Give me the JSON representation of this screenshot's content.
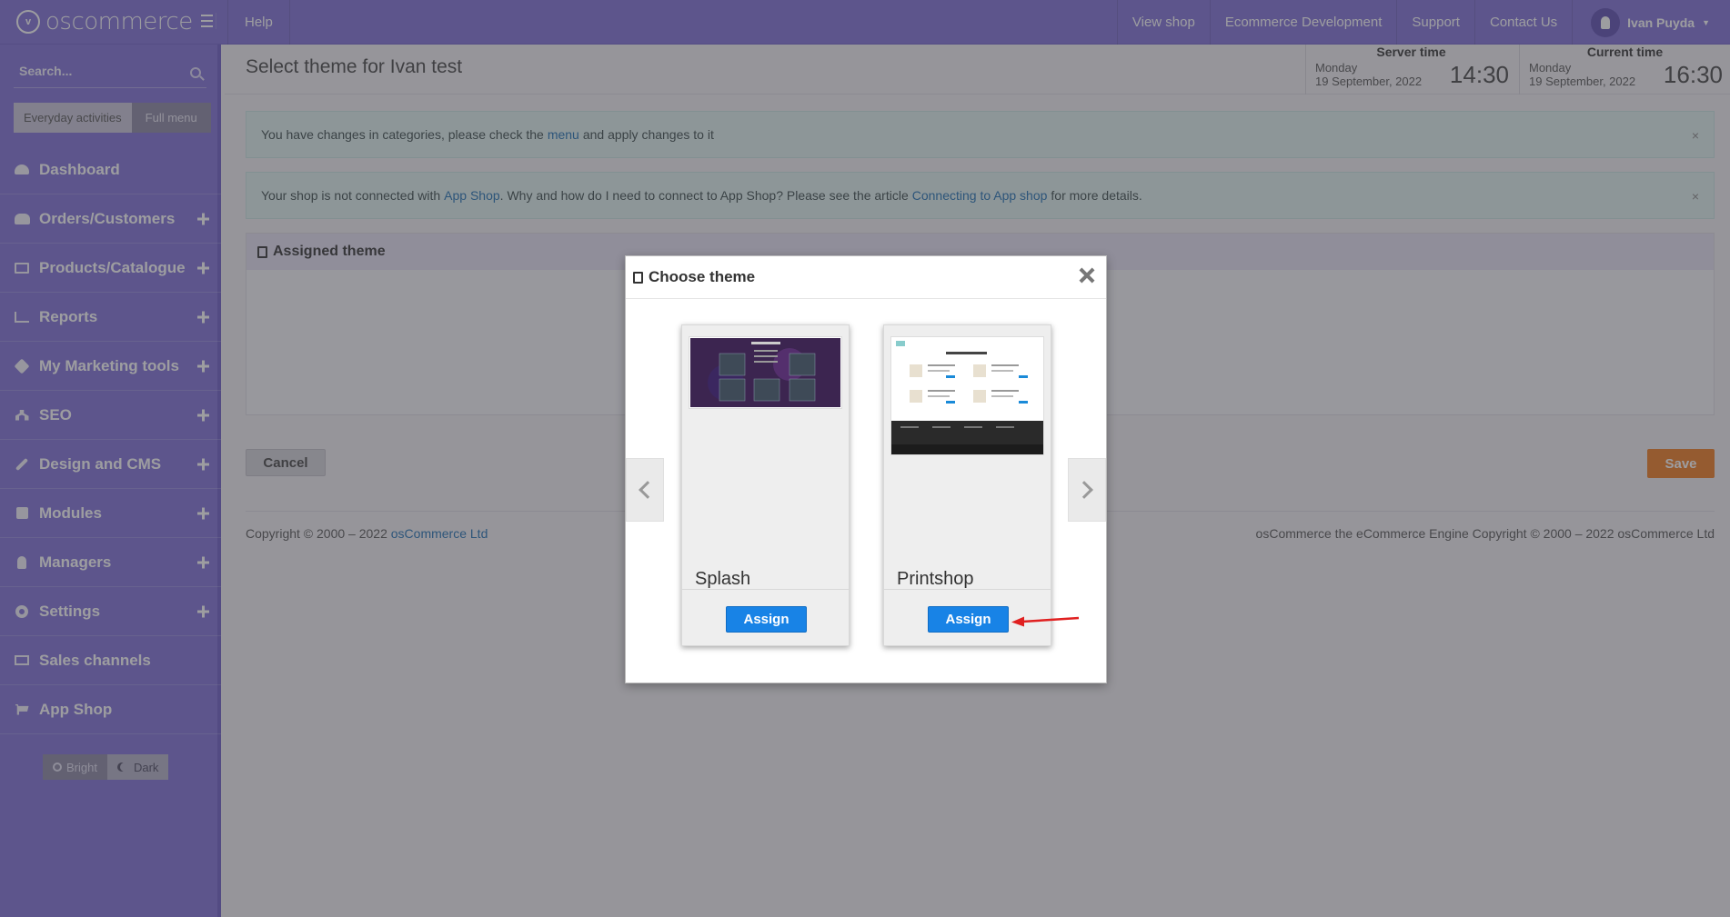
{
  "topbar": {
    "logo": "oscommerce",
    "help": "Help",
    "links": [
      "View shop",
      "Ecommerce Development",
      "Support",
      "Contact Us"
    ],
    "user": "Ivan Puyda"
  },
  "sidebar": {
    "search_placeholder": "Search...",
    "mode_active": "Everyday activities",
    "mode_inactive": "Full menu",
    "items": [
      {
        "label": "Dashboard",
        "icon": "dashboard-icon",
        "expandable": false
      },
      {
        "label": "Orders/Customers",
        "icon": "users-icon",
        "expandable": true
      },
      {
        "label": "Products/Catalogue",
        "icon": "folder-icon",
        "expandable": true
      },
      {
        "label": "Reports",
        "icon": "chart-icon",
        "expandable": true
      },
      {
        "label": "My Marketing tools",
        "icon": "tag-icon",
        "expandable": true
      },
      {
        "label": "SEO",
        "icon": "sitemap-icon",
        "expandable": true
      },
      {
        "label": "Design and CMS",
        "icon": "brush-icon",
        "expandable": true
      },
      {
        "label": "Modules",
        "icon": "puzzle-icon",
        "expandable": true
      },
      {
        "label": "Managers",
        "icon": "user-icon",
        "expandable": true
      },
      {
        "label": "Settings",
        "icon": "cogs-icon",
        "expandable": true
      },
      {
        "label": "Sales channels",
        "icon": "monitor-icon",
        "expandable": false
      },
      {
        "label": "App Shop",
        "icon": "cart-icon",
        "expandable": false
      }
    ],
    "theme_bright": "Bright",
    "theme_dark": "Dark"
  },
  "main": {
    "title": "Select theme for Ivan test",
    "server_time": {
      "label": "Server time",
      "day": "Monday",
      "date": "19 September, 2022",
      "time": "14:30"
    },
    "current_time": {
      "label": "Current time",
      "day": "Monday",
      "date": "19 September, 2022",
      "time": "16:30"
    },
    "alert1": {
      "before": "You have changes in categories, please check the",
      "link": "menu",
      "after": "and apply changes to it",
      "close": "×"
    },
    "alert2": {
      "before": "Your shop is not connected with",
      "link1": "App Shop",
      "middle": ". Why and how do I need to connect to App Shop? Please see the article",
      "link2": "Connecting to App shop",
      "after": "for more details.",
      "close": "×"
    },
    "panel_title": "Assigned theme",
    "cancel": "Cancel",
    "save": "Save",
    "footer_left": "Copyright © 2000 – 2022",
    "footer_left_link": "osCommerce Ltd",
    "footer_right": "osCommerce the eCommerce Engine Copyright © 2000 – 2022 osCommerce Ltd"
  },
  "modal": {
    "title": "Choose theme",
    "themes": [
      {
        "name": "Splash",
        "button": "Assign"
      },
      {
        "name": "Printshop",
        "button": "Assign"
      }
    ]
  },
  "colors": {
    "accent": "#7e6fd6",
    "save": "#ee7a1f",
    "assign": "#1883e6",
    "annotation": "#e02020"
  }
}
